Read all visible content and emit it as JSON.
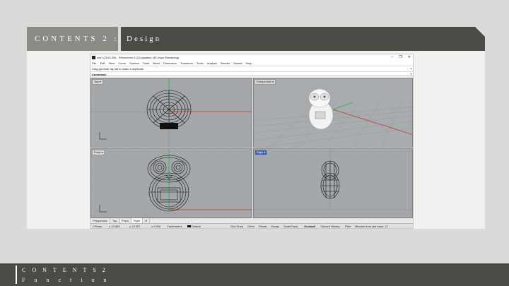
{
  "slide": {
    "section_label": "CONTENTS 2 ::",
    "section_title": "Design",
    "footer_line1": "CONTENTS2",
    "footer_line2": "Function"
  },
  "rhino": {
    "window_title": "owl1 (2015 KB) - Rhinoceros 5.0 Evaluation (35 Days Remaining)",
    "window_controls": [
      "–",
      "❐",
      "✕"
    ],
    "menu": [
      "File",
      "Edit",
      "View",
      "Curve",
      "Surface",
      "Solid",
      "Mesh",
      "Dimension",
      "Transform",
      "Tools",
      "Analyze",
      "Render",
      "Panels",
      "Help"
    ],
    "history_text": "Drag gumball; tap Alt to make a duplicate",
    "command_label": "Command:",
    "viewports": {
      "top": "Top",
      "perspective": "Perspective",
      "front": "Front",
      "right": "Right"
    },
    "viewport_tabs": [
      "Perspective",
      "Top",
      "Front",
      "Right",
      "⊕"
    ],
    "status": {
      "cplane": "CPlane",
      "x": "x 12.663",
      "y": "y 12.507",
      "z": "z 0.000",
      "units": "Centimeters",
      "layer": "Default",
      "toggles": [
        "Grid Snap",
        "Ortho",
        "Planar",
        "Osnap",
        "SmartTrack",
        "Gumball",
        "Record History",
        "Filter"
      ],
      "save_info": "Minutes from last save: 12"
    }
  },
  "colors": {
    "header_light": "#8b8b86",
    "header_dark": "#4b4b46",
    "viewport_bg": "#a5a8ab",
    "axis_x": "#c0392b",
    "axis_y": "#27ae60",
    "active_label": "#3a63b5"
  }
}
